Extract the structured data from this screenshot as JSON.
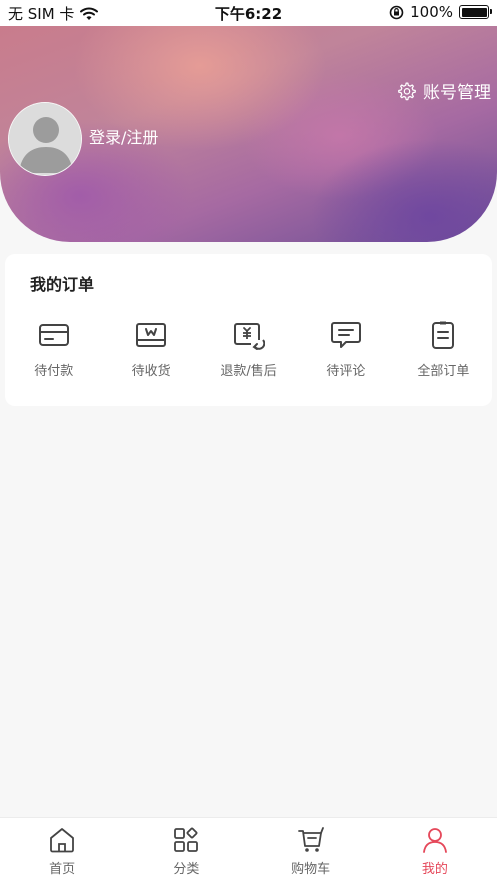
{
  "status_bar": {
    "carrier": "无 SIM 卡",
    "time": "下午6:22",
    "battery": "100%"
  },
  "header": {
    "account_management": "账号管理",
    "login_register": "登录/注册"
  },
  "orders": {
    "title": "我的订单",
    "items": [
      {
        "label": "待付款",
        "icon": "card-icon"
      },
      {
        "label": "待收货",
        "icon": "package-icon"
      },
      {
        "label": "退款/售后",
        "icon": "refund-icon"
      },
      {
        "label": "待评论",
        "icon": "comment-icon"
      },
      {
        "label": "全部订单",
        "icon": "clipboard-icon"
      }
    ]
  },
  "tabbar": {
    "items": [
      {
        "label": "首页",
        "icon": "home-icon"
      },
      {
        "label": "分类",
        "icon": "category-icon"
      },
      {
        "label": "购物车",
        "icon": "cart-icon"
      },
      {
        "label": "我的",
        "icon": "user-icon"
      }
    ],
    "active_index": 3,
    "active_color": "#e5485a"
  }
}
